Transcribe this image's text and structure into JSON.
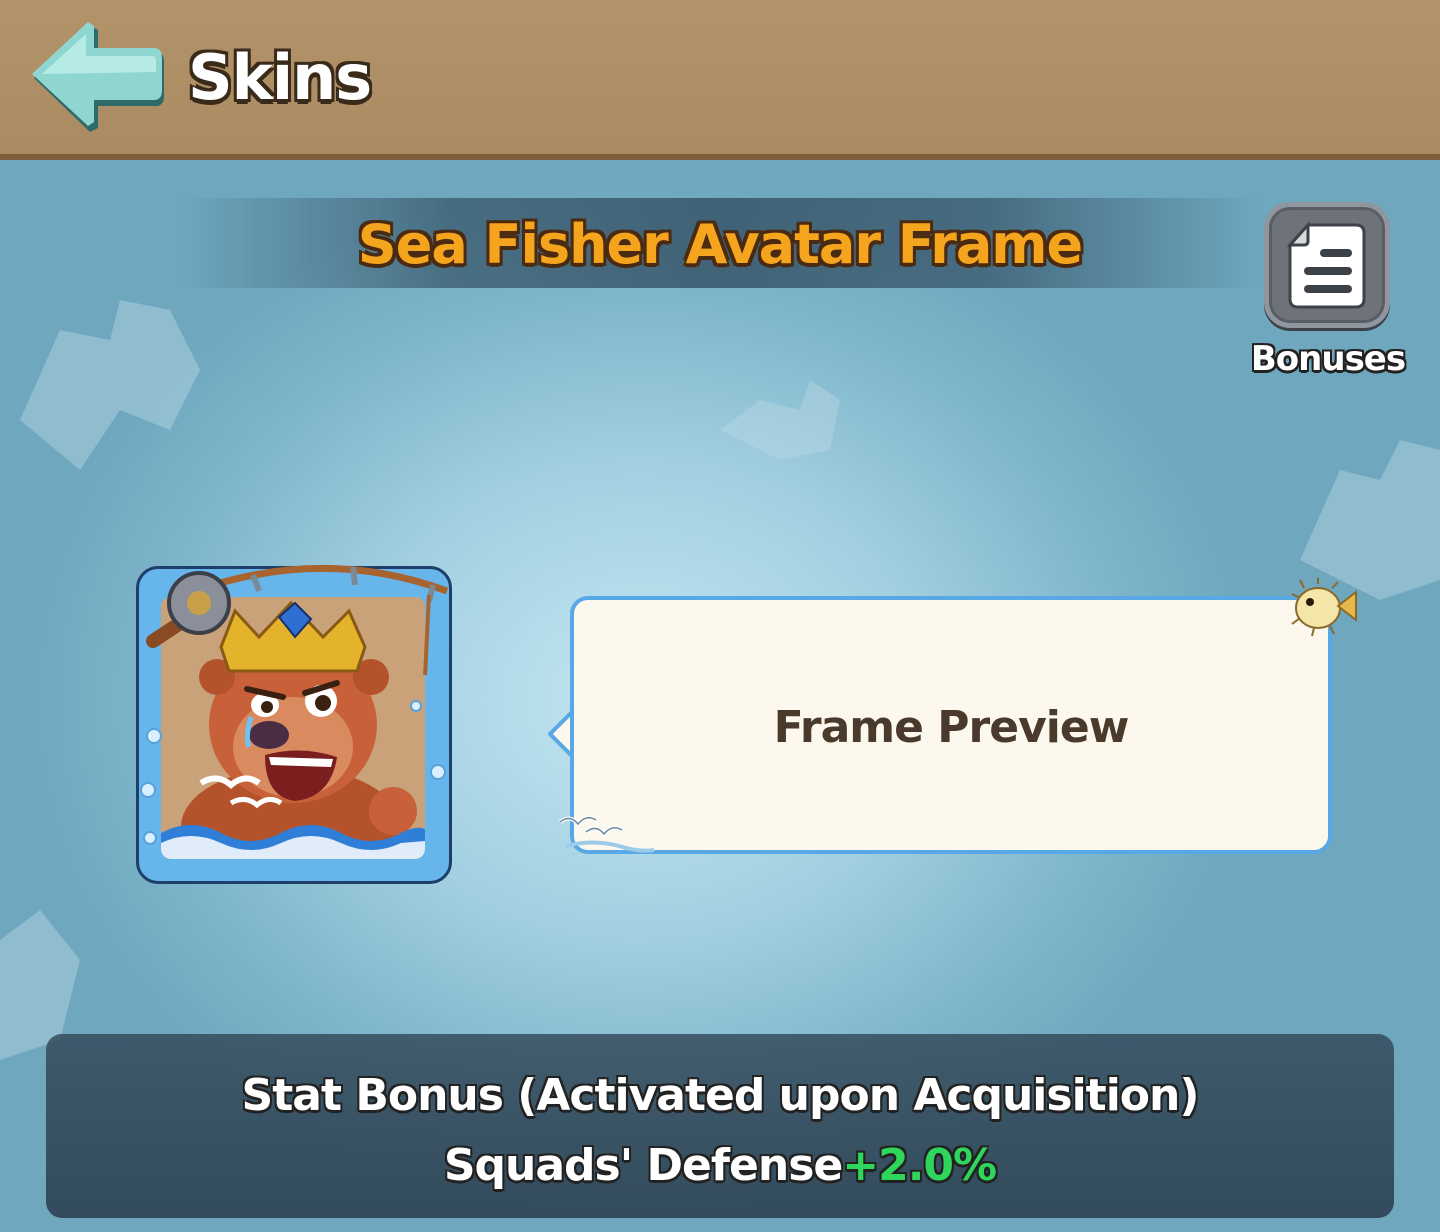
{
  "header": {
    "title": "Skins",
    "back_icon": "back-arrow-icon"
  },
  "skin": {
    "title": "Sea Fisher Avatar Frame",
    "preview_label": "Frame Preview"
  },
  "bonuses_button": {
    "label": "Bonuses",
    "icon": "document-list-icon"
  },
  "stat_bonus": {
    "heading": "Stat Bonus (Activated upon Acquisition)",
    "stat_name": "Squads' Defense",
    "stat_value": "+2.0%"
  },
  "colors": {
    "title_orange": "#f5a41e",
    "bonus_green": "#2fd65c",
    "header_brown": "#b3936a",
    "bubble_border": "#58a8e6"
  }
}
